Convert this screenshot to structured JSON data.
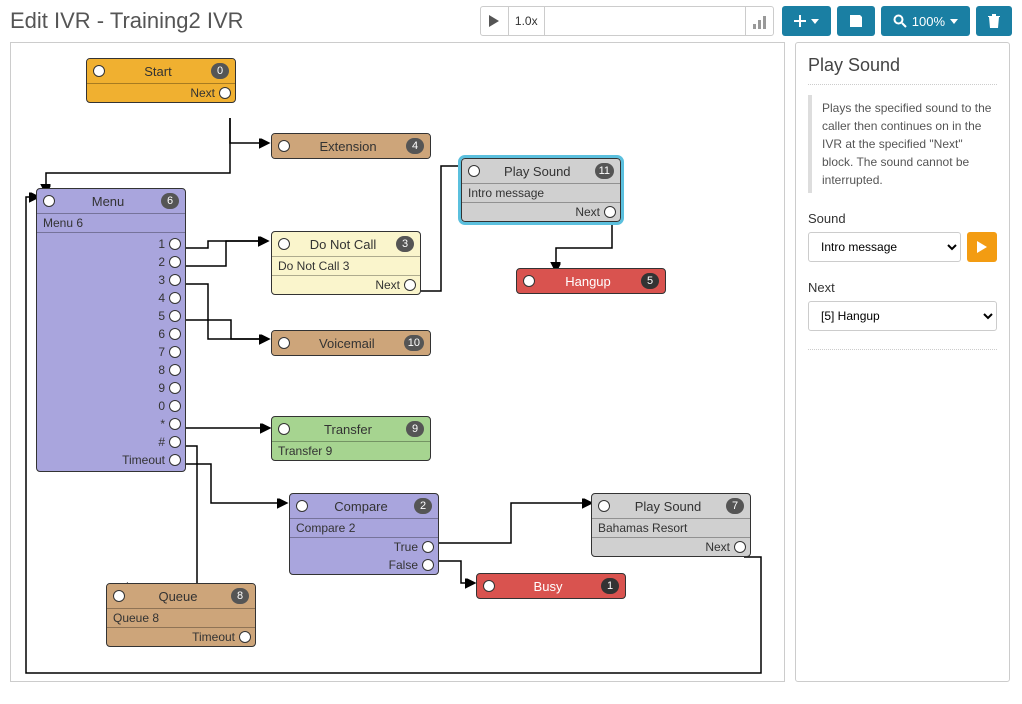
{
  "header": {
    "title": "Edit IVR - Training2 IVR",
    "speed": "1.0x",
    "zoom": "100%"
  },
  "nodes": {
    "start": {
      "title": "Start",
      "id": "0",
      "out": "Next"
    },
    "extension": {
      "title": "Extension",
      "id": "4"
    },
    "menu": {
      "title": "Menu",
      "id": "6",
      "sub": "Menu 6",
      "opts": [
        "1",
        "2",
        "3",
        "4",
        "5",
        "6",
        "7",
        "8",
        "9",
        "0",
        "*",
        "#",
        "Timeout"
      ]
    },
    "dnc": {
      "title": "Do Not Call",
      "id": "3",
      "sub": "Do Not Call 3",
      "out": "Next"
    },
    "voicemail": {
      "title": "Voicemail",
      "id": "10"
    },
    "transfer": {
      "title": "Transfer",
      "id": "9",
      "sub": "Transfer 9"
    },
    "compare": {
      "title": "Compare",
      "id": "2",
      "sub": "Compare 2",
      "outs": [
        "True",
        "False"
      ]
    },
    "queue": {
      "title": "Queue",
      "id": "8",
      "sub": "Queue 8",
      "out": "Timeout"
    },
    "busy": {
      "title": "Busy",
      "id": "1"
    },
    "playsound11": {
      "title": "Play Sound",
      "id": "11",
      "sub": "Intro message",
      "out": "Next"
    },
    "hangup": {
      "title": "Hangup",
      "id": "5"
    },
    "playsound7": {
      "title": "Play Sound",
      "id": "7",
      "sub": "Bahamas Resort",
      "out": "Next"
    }
  },
  "side": {
    "title": "Play Sound",
    "desc": "Plays the specified sound to the caller then continues on in the IVR at the specified \"Next\" block. The sound cannot be interrupted.",
    "sound_label": "Sound",
    "sound_value": "Intro message",
    "next_label": "Next",
    "next_value": "[5] Hangup"
  }
}
